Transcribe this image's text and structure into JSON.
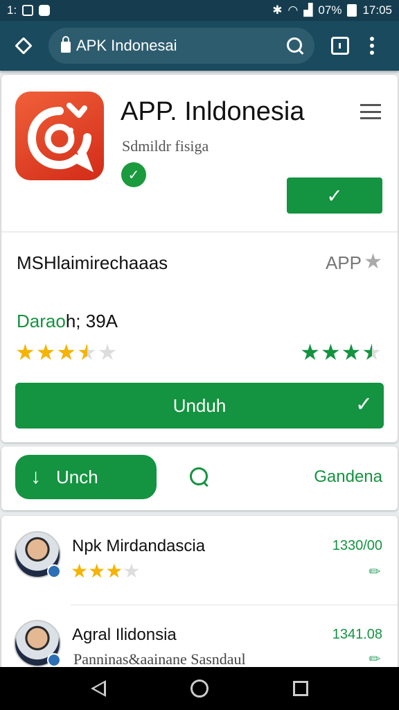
{
  "status_bar": {
    "time_left": "1:",
    "battery": "07%",
    "clock": "17:05"
  },
  "toolbar": {
    "url": "APK Indonesai"
  },
  "app": {
    "title": "APP. Inldonesia",
    "subtitle": "Sdmildr fisiga",
    "install_check": "✓",
    "developer": "MSHlaimirechaaas",
    "tag": "APP",
    "size_label": "Darao",
    "size_value": "h; 39A",
    "rating_left": 3.5,
    "rating_right": 3.5,
    "download_label": "Unduh"
  },
  "actions": {
    "primary_label": "Unch",
    "secondary_label": "Gandena"
  },
  "reviews": [
    {
      "name": "Npk Mirdandascia",
      "meta": "1330/00",
      "stars": 3
    },
    {
      "name": "Agral Ilidonsia",
      "meta": "1341.08",
      "text": "Panninas&aainane Sasndaul"
    }
  ],
  "colors": {
    "status_bar": "#153d4f",
    "toolbar": "#1a4a5e",
    "accent_green": "#149340",
    "star_yellow": "#f4b400",
    "app_icon": "#e5472a"
  }
}
